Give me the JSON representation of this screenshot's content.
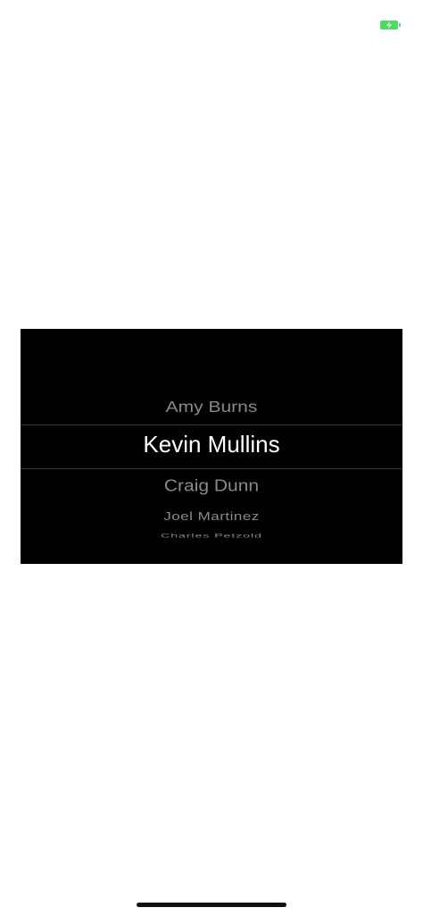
{
  "status_bar": {
    "battery_color": "#4cd964",
    "battery_icon": "battery-charging-icon"
  },
  "picker": {
    "items": [
      {
        "label": "Amy Burns"
      },
      {
        "label": "Kevin Mullins"
      },
      {
        "label": "Craig Dunn"
      },
      {
        "label": "Joel Martinez"
      },
      {
        "label": "Charles Petzold"
      }
    ],
    "selected_label": "Kevin Mullins"
  }
}
